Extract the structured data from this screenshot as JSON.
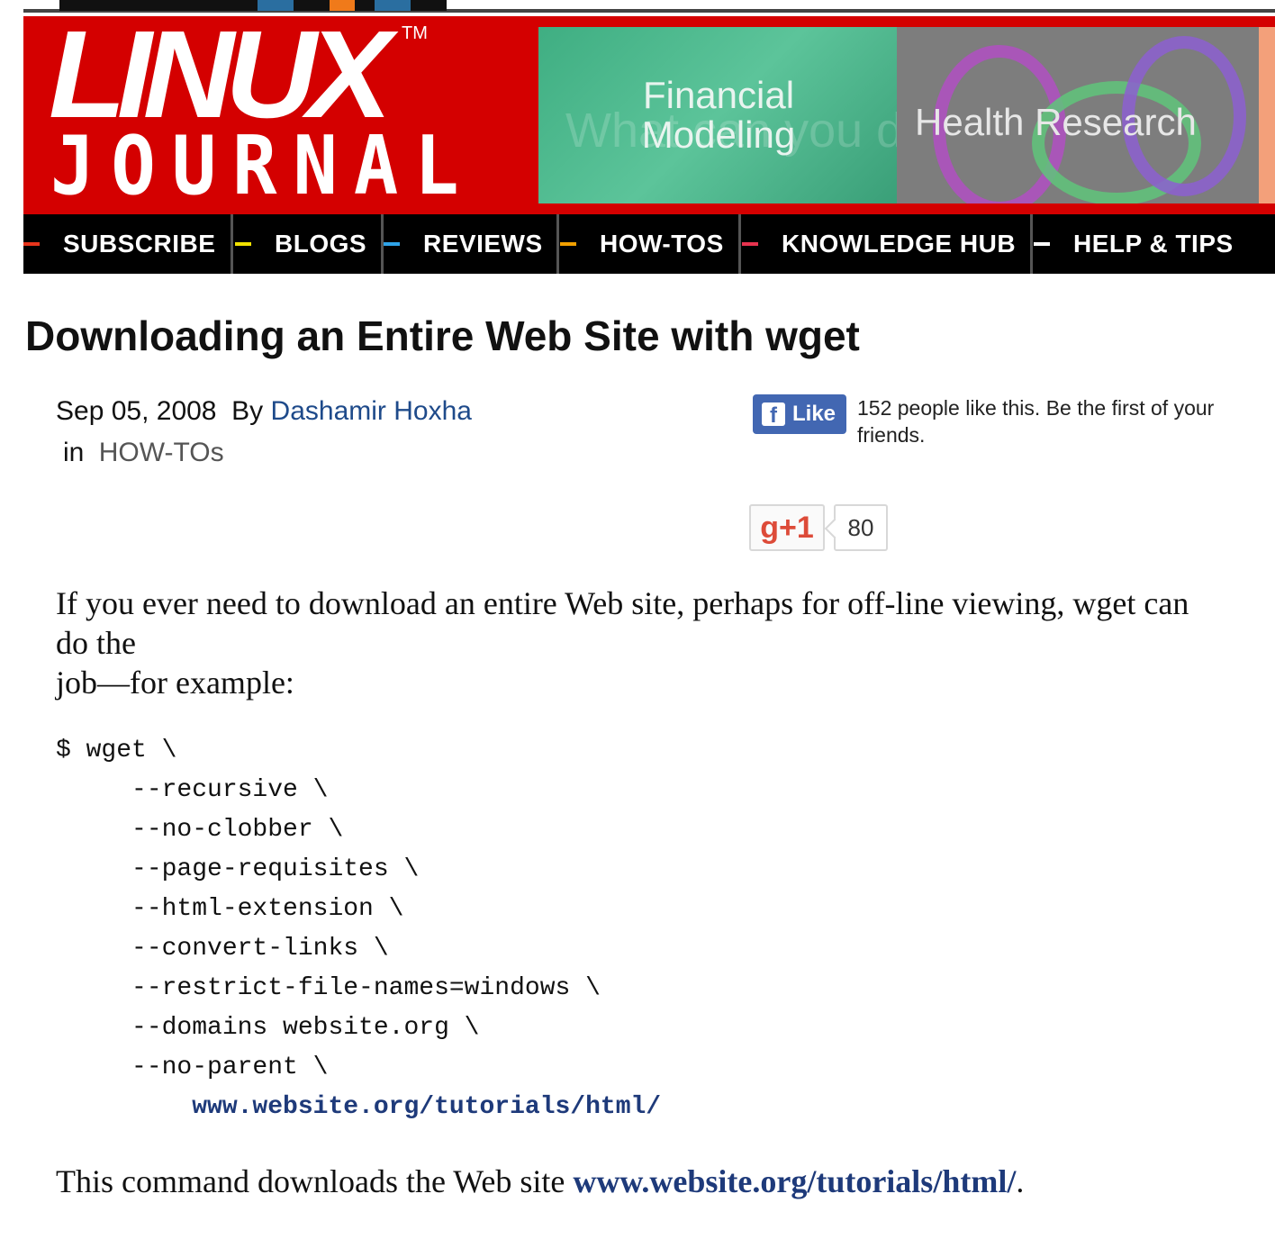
{
  "header": {
    "logo_top": "LINUX",
    "logo_tm": "TM",
    "logo_bottom": "JOURNAL",
    "banners": [
      "Financial Modeling",
      "Health Research"
    ],
    "banner_ghost_text": "What can you do with Scientific Fo"
  },
  "nav": {
    "items": [
      {
        "label": "SUBSCRIBE",
        "color": "#e8351c"
      },
      {
        "label": "BLOGS",
        "color": "#f2e200"
      },
      {
        "label": "REVIEWS",
        "color": "#2ea3e8"
      },
      {
        "label": "HOW-TOS",
        "color": "#f2a000"
      },
      {
        "label": "KNOWLEDGE HUB",
        "color": "#e8334f"
      },
      {
        "label": "HELP & TIPS",
        "color": "#ffffff"
      }
    ]
  },
  "article": {
    "title": "Downloading an Entire Web Site with wget",
    "date": "Sep 05, 2008",
    "by": "By",
    "author": "Dashamir Hoxha",
    "in": "in",
    "category": "HOW-TOs",
    "intro": "If you ever need to download an entire Web site, perhaps for off-line viewing, wget can do the",
    "intro_cont": "job—for example:",
    "code_lines": [
      "$ wget \\",
      "     --recursive \\",
      "     --no-clobber \\",
      "     --page-requisites \\",
      "     --html-extension \\",
      "     --convert-links \\",
      "     --restrict-file-names=windows \\",
      "     --domains website.org \\",
      "     --no-parent \\"
    ],
    "code_url": "         www.website.org/tutorials/html/",
    "outro_prefix": "This command downloads the Web site ",
    "outro_link": "www.website.org/tutorials/html/",
    "outro_suffix": "."
  },
  "social": {
    "fb_label": "Like",
    "fb_icon": "facebook-icon",
    "fb_text": "152 people like this. Be the first of your friends.",
    "gplus_label": "g+1",
    "gplus_count": "80"
  }
}
